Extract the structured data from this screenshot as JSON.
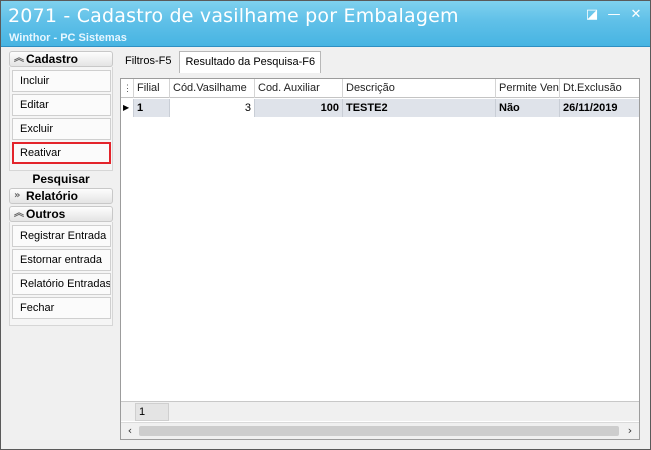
{
  "window": {
    "title": "2071 - Cadastro de vasilhame por Embalagem",
    "subtitle": "Winthor - PC Sistemas",
    "buttons": {
      "restore": "◪",
      "minimize": "—",
      "close": "✕"
    }
  },
  "sidebar": {
    "cadastro": {
      "header": "Cadastro",
      "items": [
        "Incluir",
        "Editar",
        "Excluir",
        "Reativar"
      ],
      "highlighted": "Reativar",
      "highlight_color": "#e3242b"
    },
    "pesquisar": "Pesquisar",
    "relatorio": {
      "header": "Relatório"
    },
    "outros": {
      "header": "Outros",
      "items": [
        "Registrar Entrada",
        "Estornar entrada",
        "Relatório Entradas",
        "Fechar"
      ]
    }
  },
  "tabs": [
    {
      "label": "Filtros-F5",
      "active": false
    },
    {
      "label": "Resultado da Pesquisa-F6",
      "active": true
    }
  ],
  "grid": {
    "columns": [
      "Filial",
      "Cód.Vasilhame",
      "Cod. Auxiliar",
      "Descrição",
      "Permite Vend",
      "Dt.Exclusão"
    ],
    "rows": [
      {
        "filial": "1",
        "cod_vasilhame": "3",
        "cod_auxiliar": "100",
        "descricao": "TESTE2",
        "permite_venda": "Não",
        "dt_exclusao": "26/11/2019"
      }
    ],
    "footer_count": "1"
  },
  "colors": {
    "titlebar": "#5fc0e8",
    "selected_row": "#dfe3ea"
  }
}
